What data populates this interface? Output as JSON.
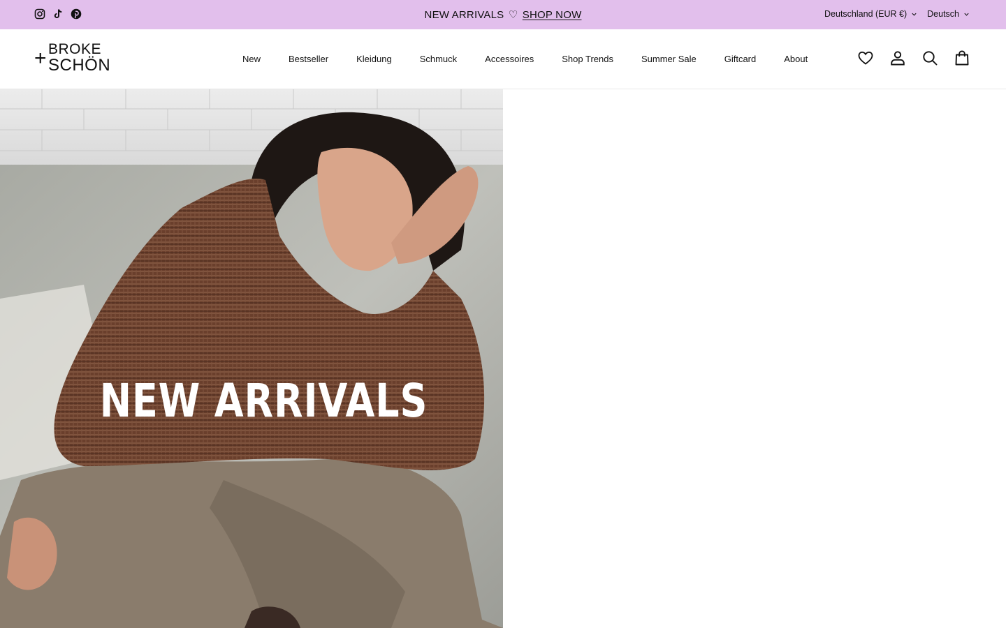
{
  "announcement": {
    "text": "NEW ARRIVALS",
    "heart": "♡",
    "link": "SHOP NOW"
  },
  "social": [
    "instagram-icon",
    "tiktok-icon",
    "pinterest-icon"
  ],
  "locale": {
    "country": "Deutschland (EUR €)",
    "language": "Deutsch"
  },
  "logo": {
    "plus": "+",
    "line1": "BROKE",
    "line2": "SCHÖN"
  },
  "nav": {
    "items": [
      "New",
      "Bestseller",
      "Kleidung",
      "Schmuck",
      "Accessoires",
      "Shop Trends",
      "Summer Sale",
      "Giftcard",
      "About"
    ]
  },
  "header_icons": [
    "heart-icon",
    "account-icon",
    "search-icon",
    "bag-icon"
  ],
  "hero": {
    "title": "NEW ARRIVALS"
  },
  "colors": {
    "announcement_bg": "#e2bfec",
    "text": "#111111"
  }
}
